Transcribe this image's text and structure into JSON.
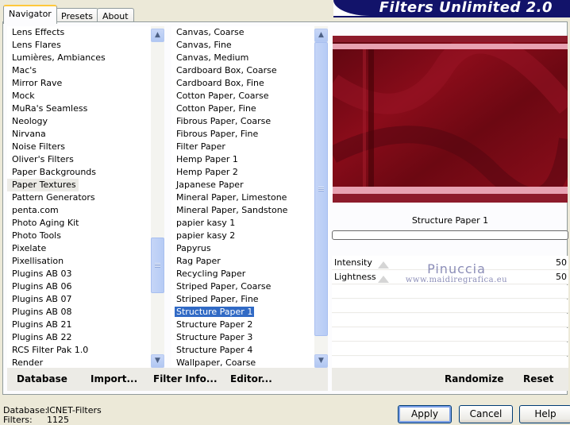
{
  "tabs": [
    "Navigator",
    "Presets",
    "About"
  ],
  "banner_title": "Filters Unlimited 2.0",
  "categories": {
    "items": [
      "Lens Effects",
      "Lens Flares",
      "Lumières, Ambiances",
      "Mac's",
      "Mirror Rave",
      "Mock",
      "MuRa's Seamless",
      "Neology",
      "Nirvana",
      "Noise Filters",
      "Oliver's Filters",
      "Paper Backgrounds",
      "Paper Textures",
      "Pattern Generators",
      "penta.com",
      "Photo Aging Kit",
      "Photo Tools",
      "Pixelate",
      "Pixellisation",
      "Plugins AB 03",
      "Plugins AB 06",
      "Plugins AB 07",
      "Plugins AB 08",
      "Plugins AB 21",
      "Plugins AB 22",
      "RCS Filter Pak 1.0",
      "Render"
    ],
    "selected": "Paper Textures"
  },
  "filters": {
    "items": [
      "Canvas, Coarse",
      "Canvas, Fine",
      "Canvas, Medium",
      "Cardboard Box, Coarse",
      "Cardboard Box, Fine",
      "Cotton Paper, Coarse",
      "Cotton Paper, Fine",
      "Fibrous Paper, Coarse",
      "Fibrous Paper, Fine",
      "Filter Paper",
      "Hemp Paper 1",
      "Hemp Paper 2",
      "Japanese Paper",
      "Mineral Paper, Limestone",
      "Mineral Paper, Sandstone",
      "papier kasy 1",
      "papier kasy 2",
      "Papyrus",
      "Rag Paper",
      "Recycling Paper",
      "Striped Paper, Coarse",
      "Striped Paper, Fine",
      "Structure Paper 1",
      "Structure Paper 2",
      "Structure Paper 3",
      "Structure Paper 4",
      "Wallpaper, Coarse"
    ],
    "selected": "Structure Paper 1"
  },
  "bottom_buttons": {
    "database": "Database",
    "import": "Import...",
    "filter_info": "Filter Info...",
    "editor": "Editor...",
    "randomize": "Randomize",
    "reset": "Reset"
  },
  "preview_name": "Structure Paper 1",
  "params": [
    {
      "label": "Intensity",
      "value": "50"
    },
    {
      "label": "Lightness",
      "value": "50"
    }
  ],
  "watermark": {
    "line1": "Pinuccia",
    "line2": "www.maidiregrafica.eu"
  },
  "footer": {
    "database_label": "Database:",
    "database_value": "ICNET-Filters",
    "filters_label": "Filters:",
    "filters_value": "1125"
  },
  "dialog_buttons": {
    "apply": "Apply",
    "cancel": "Cancel",
    "help": "Help"
  },
  "colors": {
    "accent": "#316ac5",
    "banner": "#12136a",
    "preview_base": "#760a14",
    "preview_band": "#e8a2b2"
  }
}
